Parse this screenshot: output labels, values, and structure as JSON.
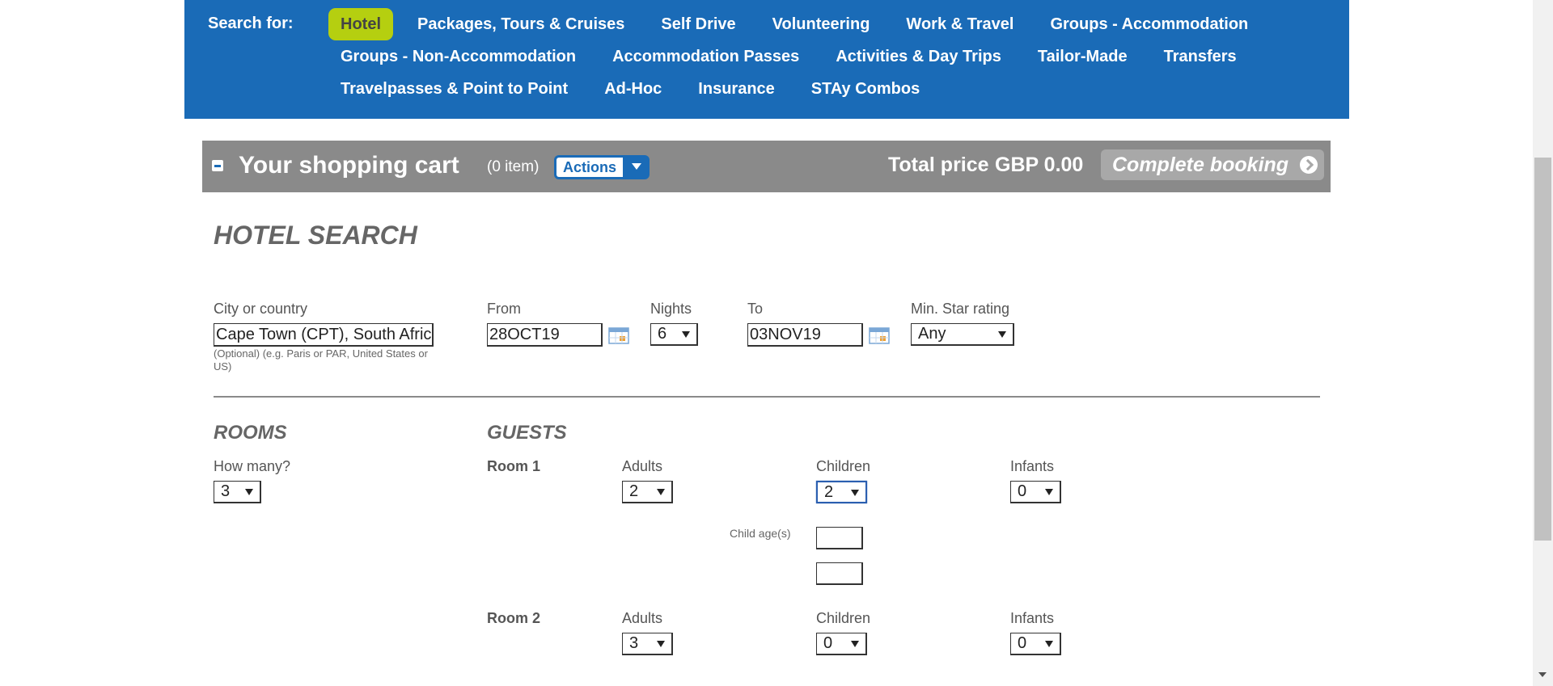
{
  "nav": {
    "search_for_label": "Search for:",
    "rows": [
      [
        "Hotel",
        "Packages, Tours & Cruises",
        "Self Drive",
        "Volunteering",
        "Work & Travel",
        "Groups - Accommodation"
      ],
      [
        "Groups - Non-Accommodation",
        "Accommodation Passes",
        "Activities & Day Trips",
        "Tailor-Made",
        "Transfers"
      ],
      [
        "Travelpasses & Point to Point",
        "Ad-Hoc",
        "Insurance",
        "STAy Combos"
      ]
    ],
    "active": "Hotel",
    "colors": {
      "bar": "#1a6bb7",
      "active": "#b5cf10"
    }
  },
  "cart": {
    "title": "Your shopping cart",
    "count": "(0 item)",
    "actions_label": "Actions",
    "total_label": "Total price",
    "total_value": "GBP 0.00",
    "complete_label": "Complete booking",
    "bar_color": "#8a8a8a"
  },
  "search": {
    "heading": "HOTEL SEARCH",
    "city_label": "City or country",
    "city_value": "Cape Town (CPT), South Afric",
    "city_note_1": "(Optional) (e.g. Paris or PAR, United States or",
    "city_note_2": "US)",
    "from_label": "From",
    "from_value": "28OCT19",
    "nights_label": "Nights",
    "nights_value": "6",
    "to_label": "To",
    "to_value": "03NOV19",
    "star_label": "Min. Star rating",
    "star_value": "Any"
  },
  "rooms": {
    "heading": "ROOMS",
    "how_many_label": "How many?",
    "how_many_value": "3"
  },
  "guests": {
    "heading": "GUESTS",
    "adults_label": "Adults",
    "children_label": "Children",
    "infants_label": "Infants",
    "child_ages_label": "Child age(s)",
    "room1": {
      "label": "Room 1",
      "adults": "2",
      "children": "2",
      "infants": "0"
    },
    "room2": {
      "label": "Room 2",
      "adults": "3",
      "children": "0",
      "infants": "0"
    }
  }
}
